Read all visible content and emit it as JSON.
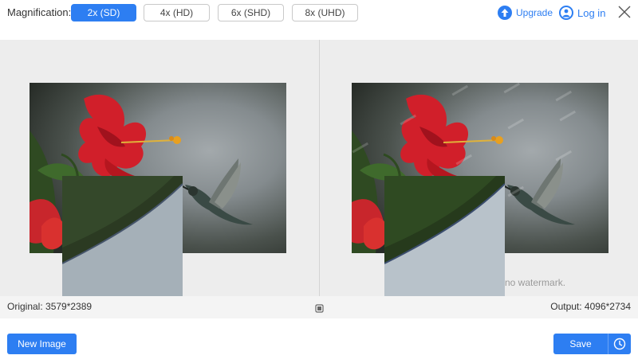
{
  "toolbar": {
    "magnification_label": "Magnification:",
    "options": [
      {
        "label": "2x (SD)",
        "active": true
      },
      {
        "label": "4x (HD)",
        "active": false
      },
      {
        "label": "6x (SHD)",
        "active": false
      },
      {
        "label": "8x (UHD)",
        "active": false
      }
    ],
    "upgrade_label": "Upgrade",
    "login_label": "Log in",
    "icons": {
      "upgrade": "upload-arrow-icon",
      "login": "user-icon",
      "close": "close-icon"
    }
  },
  "preview": {
    "watermark_note": "no watermark."
  },
  "info": {
    "original": "Original: 3579*2389",
    "output": "Output: 4096*2734",
    "compare_icon": "compare-toggle-icon"
  },
  "footer": {
    "new_image_label": "New Image",
    "save_label": "Save",
    "history_icon": "clock-icon"
  },
  "colors": {
    "accent": "#2d7ef2",
    "preview_bg": "#ededed"
  }
}
